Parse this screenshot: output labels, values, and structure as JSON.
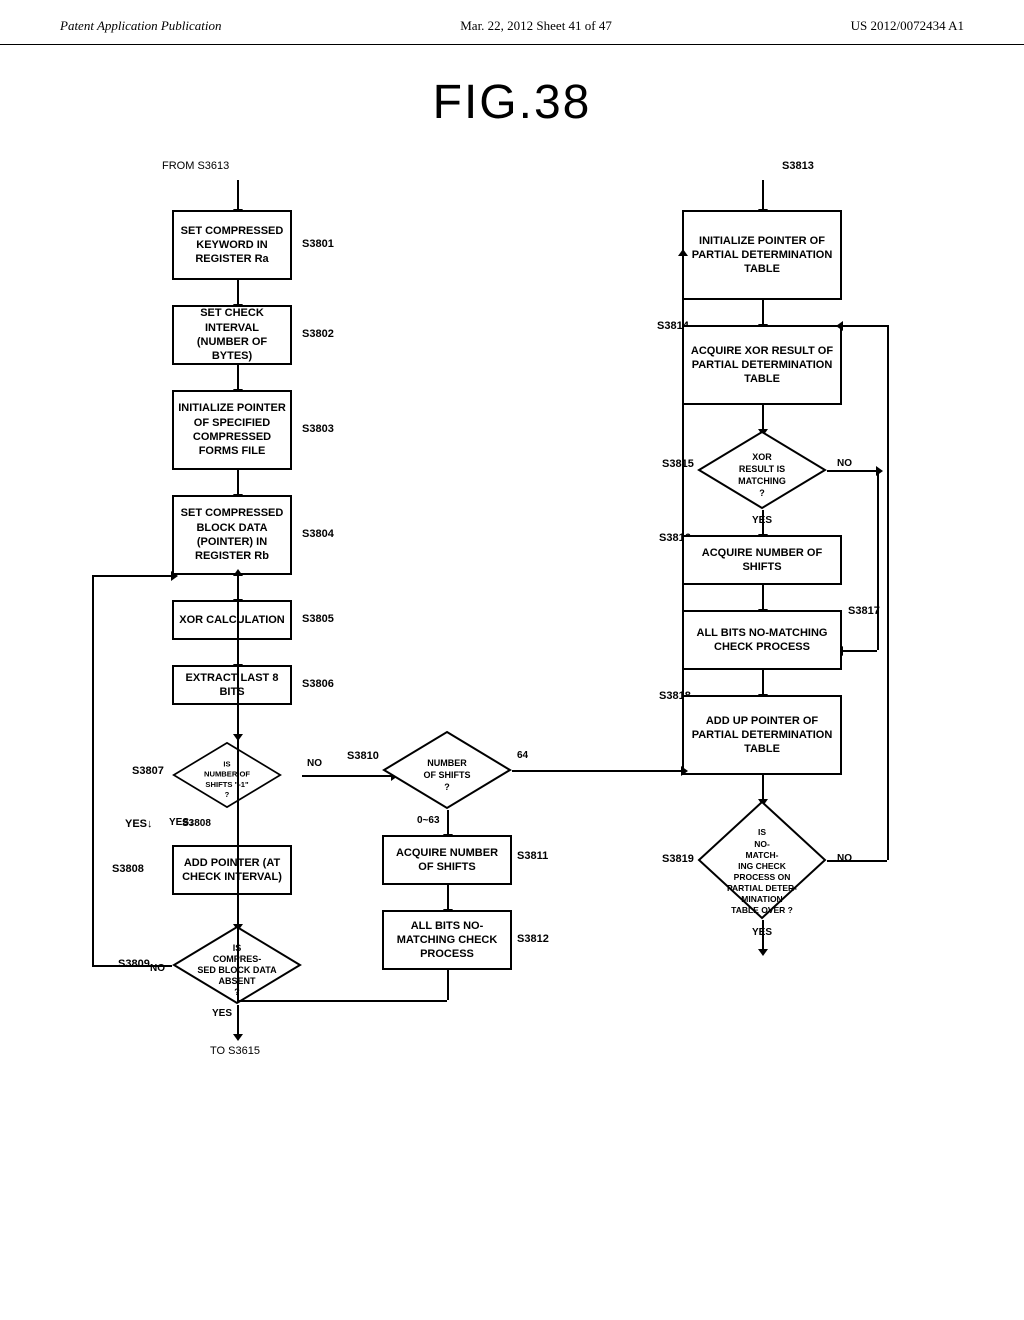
{
  "header": {
    "left": "Patent Application Publication",
    "center": "Mar. 22, 2012  Sheet 41 of 47",
    "right": "US 2012/0072434 A1"
  },
  "figure": {
    "title": "FIG.38"
  },
  "labels": {
    "from": "FROM S3613",
    "to": "TO S3615",
    "s3801": "S3801",
    "s3802": "S3802",
    "s3803": "S3803",
    "s3804": "S3804",
    "s3805": "S3805",
    "s3806": "S3806",
    "s3807": "S3807",
    "s3808": "S3808",
    "s3809": "S3809",
    "s3810": "S3810",
    "s3811": "S3811",
    "s3812": "S3812",
    "s3813": "S3813",
    "s3814": "S3814",
    "s3815": "S3815",
    "s3816": "S3816",
    "s3817": "S3817",
    "s3818": "S3818",
    "s3819": "S3819",
    "yes": "YES",
    "no": "NO",
    "no2": "NO",
    "no3": "NO",
    "yes2": "YES",
    "yes3": "YES",
    "shifts64": "64",
    "shifts0_63": "0~63"
  },
  "boxes": {
    "b3801": "SET COMPRESSED KEYWORD IN REGISTER Ra",
    "b3802": "SET CHECK INTERVAL (NUMBER OF BYTES)",
    "b3803": "INITIALIZE POINTER OF SPECIFIED COMPRESSED FORMS FILE",
    "b3804": "SET COMPRESSED BLOCK DATA (POINTER) IN REGISTER Rb",
    "b3805": "XOR CALCULATION",
    "b3806": "EXTRACT LAST 8 BITS",
    "b3808": "ADD POINTER (AT CHECK INTERVAL)",
    "b3810": "NUMBER OF SHIFTS ?",
    "b3811": "ACQUIRE NUMBER OF SHIFTS",
    "b3812": "ALL BITS NO-MATCHING CHECK PROCESS",
    "b3813": "INITIALIZE POINTER OF PARTIAL DETERMINATION TABLE",
    "b3814": "ACQUIRE XOR RESULT OF PARTIAL DETERMINATION TABLE",
    "b3815_q": "XOR RESULT IS MATCHING ?",
    "b3816": "ACQUIRE NUMBER OF SHIFTS",
    "b3817": "ALL BITS NO-MATCHING CHECK PROCESS",
    "b3818": "ADD UP POINTER OF PARTIAL DETERMINATION TABLE",
    "b3819_q": "IS NO-MATCHING CHECK PROCESS ON PARTIAL DETERMINATION TABLE OVER ?",
    "d3807_q": "IS NUMBER OF SHIFTS \"-1\" ?",
    "d3809_q": "IS COMPRESSED BLOCK DATA ABSENT ?"
  }
}
